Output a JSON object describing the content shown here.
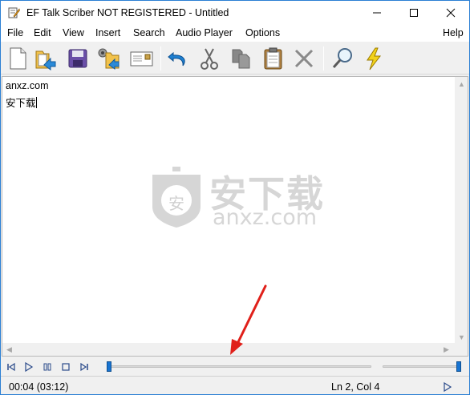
{
  "window": {
    "title": "EF Talk Scriber NOT REGISTERED - Untitled"
  },
  "menu": {
    "items": [
      {
        "id": "file",
        "label": "File"
      },
      {
        "id": "edit",
        "label": "Edit"
      },
      {
        "id": "view",
        "label": "View"
      },
      {
        "id": "insert",
        "label": "Insert"
      },
      {
        "id": "search",
        "label": "Search"
      },
      {
        "id": "audio-player",
        "label": "Audio Player"
      },
      {
        "id": "options",
        "label": "Options"
      }
    ],
    "help": "Help"
  },
  "toolbar": {
    "buttons": [
      "new-document-icon",
      "open-folder-icon",
      "save-icon",
      "open-audio-icon",
      "email-icon",
      "undo-icon",
      "cut-icon",
      "copy-icon",
      "paste-icon",
      "delete-icon",
      "find-icon",
      "lightning-icon"
    ]
  },
  "editor": {
    "lines": [
      "anxz.com",
      "安下载"
    ]
  },
  "watermark": {
    "text": "安下载",
    "subtext": "anxz.com",
    "badge": "安"
  },
  "player": {
    "position_fraction": 0.0,
    "volume_fraction": 1.0
  },
  "status": {
    "time": "00:04 (03:12)",
    "cursor": "Ln 2, Col 4"
  },
  "colors": {
    "accent": "#1874d2",
    "annotation": "#e0201a",
    "watermark": "#d4d4d4"
  }
}
